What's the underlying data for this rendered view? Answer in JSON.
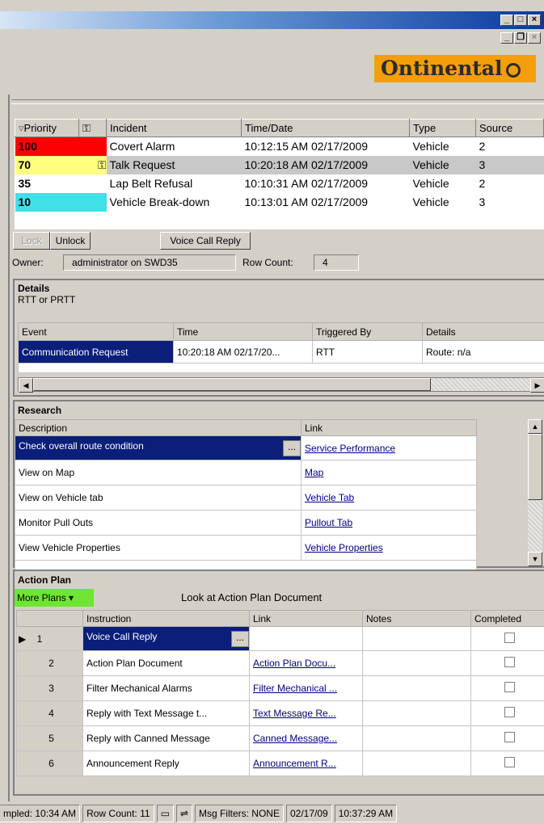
{
  "brand": "Ontinental",
  "incidents": {
    "columns": [
      "Priority",
      "Incident",
      "Time/Date",
      "Type",
      "Source"
    ],
    "rows": [
      {
        "priority": "100",
        "color": "#ff0000",
        "incident": "Covert Alarm",
        "time": "10:12:15 AM 02/17/2009",
        "type": "Vehicle",
        "source": "2"
      },
      {
        "priority": "70",
        "color": "#ffff80",
        "incident": "Talk Request",
        "time": "10:20:18 AM 02/17/2009",
        "type": "Vehicle",
        "source": "3"
      },
      {
        "priority": "35",
        "color": "#ffffff",
        "incident": "Lap Belt Refusal",
        "time": "10:10:31 AM 02/17/2009",
        "type": "Vehicle",
        "source": "2"
      },
      {
        "priority": "10",
        "color": "#40e0e8",
        "incident": "Vehicle Break-down",
        "time": "10:13:01 AM 02/17/2009",
        "type": "Vehicle",
        "source": "3"
      }
    ]
  },
  "controls": {
    "lock": "Lock",
    "unlock": "Unlock",
    "voice_call": "Voice Call Reply",
    "owner_label": "Owner:",
    "owner_value": "administrator on SWD35",
    "rowcount_label": "Row Count:",
    "rowcount_value": "4"
  },
  "details": {
    "title": "Details",
    "subtitle": "RTT or PRTT",
    "columns": [
      "Event",
      "Time",
      "Triggered By",
      "Details"
    ],
    "row": {
      "event": "Communication Request",
      "time": "10:20:18 AM 02/17/20...",
      "triggered": "RTT",
      "details": "Route: n/a"
    }
  },
  "research": {
    "title": "Research",
    "columns": [
      "Description",
      "Link"
    ],
    "rows": [
      {
        "desc": "Check overall route condition",
        "link": "Service Performance"
      },
      {
        "desc": "View on Map",
        "link": "Map"
      },
      {
        "desc": "View on Vehicle tab",
        "link": "Vehicle Tab"
      },
      {
        "desc": "Monitor Pull Outs",
        "link": "Pullout Tab"
      },
      {
        "desc": "View Vehicle Properties",
        "link": "Vehicle Properties"
      }
    ]
  },
  "action_plan": {
    "title": "Action Plan",
    "more_plans": "More Plans",
    "current_doc": "Look at Action Plan Document",
    "columns": [
      "Instruction",
      "Link",
      "Notes",
      "Completed"
    ],
    "rows": [
      {
        "num": "1",
        "instruction": "Voice Call Reply",
        "link": ""
      },
      {
        "num": "2",
        "instruction": "Action Plan Document",
        "link": "Action Plan Docu..."
      },
      {
        "num": "3",
        "instruction": "Filter Mechanical Alarms",
        "link": "Filter Mechanical ..."
      },
      {
        "num": "4",
        "instruction": "Reply with Text Message t...",
        "link": "Text Message Re..."
      },
      {
        "num": "5",
        "instruction": "Reply with Canned Message",
        "link": "Canned Message..."
      },
      {
        "num": "6",
        "instruction": "Announcement Reply",
        "link": "Announcement R..."
      }
    ]
  },
  "status": {
    "sampled": "mpled: 10:34 AM",
    "rowcount": "Row Count: 11",
    "msg_filters": "Msg Filters: NONE",
    "date": "02/17/09",
    "time": "10:37:29 AM"
  }
}
